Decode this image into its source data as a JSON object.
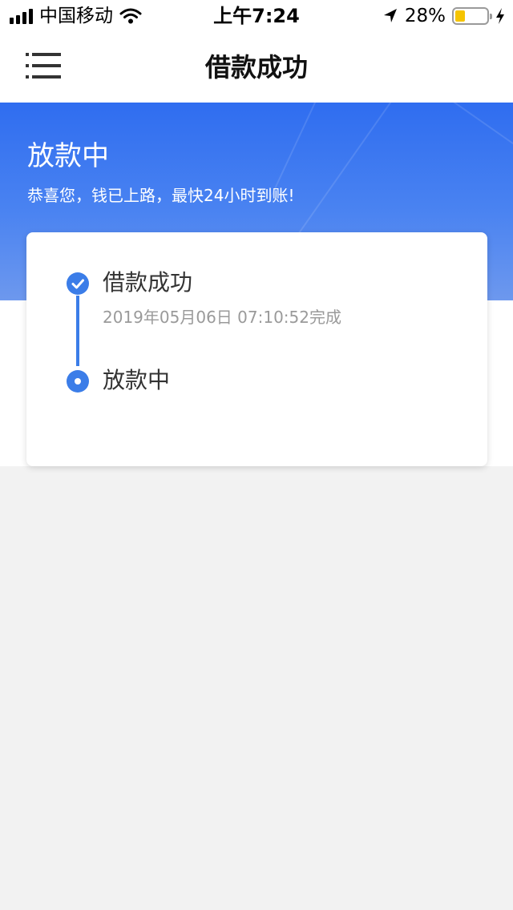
{
  "status_bar": {
    "carrier": "中国移动",
    "time": "上午7:24",
    "battery_percent": "28%",
    "battery_level": 0.28,
    "icons": [
      "signal-icon",
      "wifi-icon",
      "location-icon",
      "battery-icon",
      "charging-icon"
    ]
  },
  "nav": {
    "title": "借款成功",
    "menu_icon": "menu-icon"
  },
  "hero": {
    "title": "放款中",
    "subtitle": "恭喜您，钱已上路，最快24小时到账!"
  },
  "timeline": {
    "steps": [
      {
        "label": "借款成功",
        "time": "2019年05月06日 07:10:52完成",
        "state": "done",
        "icon": "check-circle-icon"
      },
      {
        "label": "放款中",
        "state": "current",
        "icon": "dot-circle-icon"
      }
    ]
  },
  "colors": {
    "accent": "#3b7de8",
    "hero_top": "#2f6df0",
    "hero_bottom": "#6d98ee",
    "battery": "#f5c400",
    "background": "#f2f2f2"
  }
}
